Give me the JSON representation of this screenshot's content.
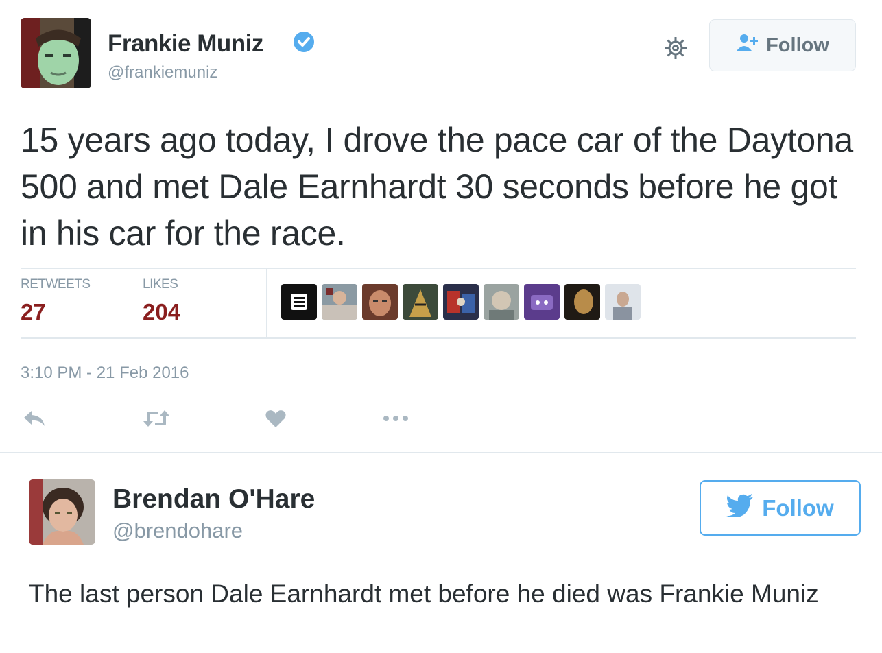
{
  "tweet1": {
    "author_name": "Frankie Muniz",
    "handle": "@frankiemuniz",
    "follow_label": "Follow",
    "text": "15 years ago today, I drove the pace car of the Daytona 500 and met Dale Earnhardt 30 seconds before he got in his car for the race.",
    "stats": {
      "retweets_label": "RETWEETS",
      "retweets_value": "27",
      "likes_label": "LIKES",
      "likes_value": "204"
    },
    "timestamp": "3:10 PM - 21 Feb 2016",
    "icons": [
      "verified-badge-icon",
      "gear-icon",
      "follow-person-icon",
      "reply-icon",
      "retweet-icon",
      "like-icon",
      "more-icon"
    ],
    "colors": {
      "stat_value": "#8a1e1e",
      "verified": "#55acee",
      "muted": "#8899a6"
    }
  },
  "tweet2": {
    "author_name": "Brendan O'Hare",
    "handle": "@brendohare",
    "follow_label": "Follow",
    "text": "The last person Dale Earnhardt met before he died was Frankie Muniz",
    "icons": [
      "twitter-bird-icon"
    ],
    "colors": {
      "accent": "#55acee"
    }
  }
}
